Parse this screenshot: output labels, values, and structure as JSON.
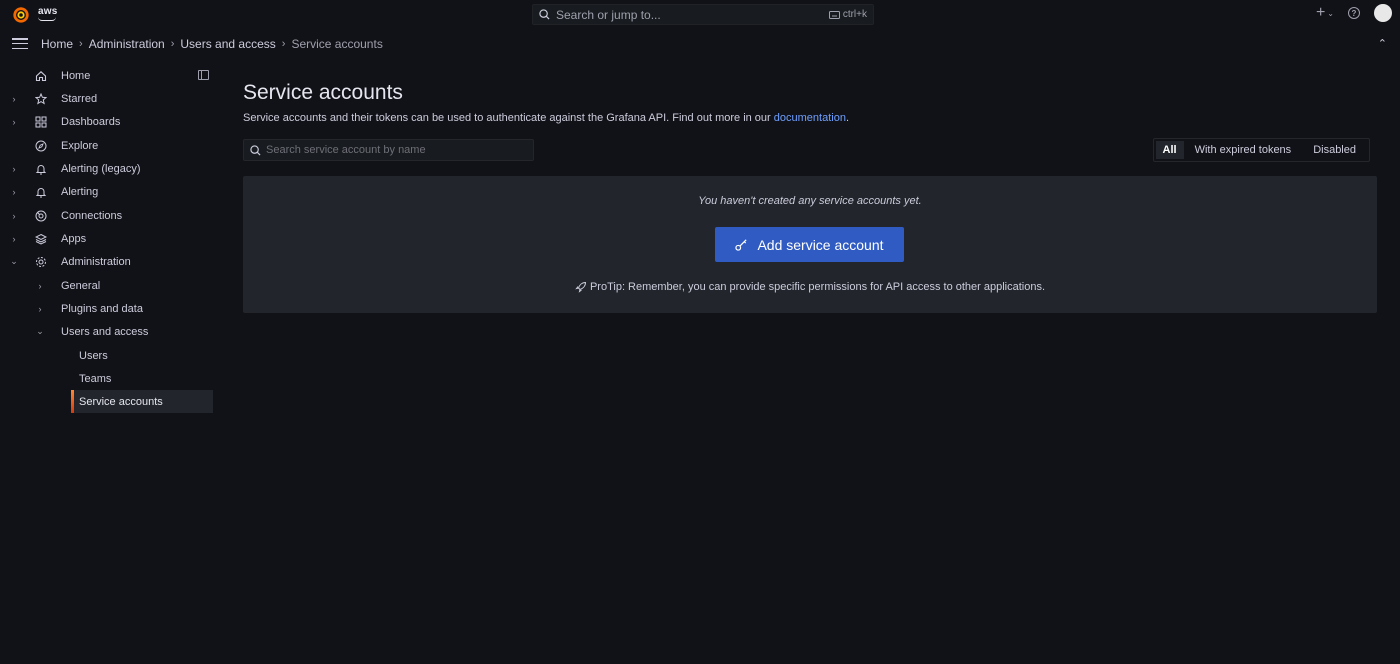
{
  "topbar": {
    "brand": "aws",
    "search_placeholder": "Search or jump to...",
    "search_shortcut": "ctrl+k",
    "plus_label": "+"
  },
  "breadcrumb": {
    "items": [
      "Home",
      "Administration",
      "Users and access",
      "Service accounts"
    ]
  },
  "sidebar": {
    "items": [
      {
        "label": "Home",
        "icon": "home-icon"
      },
      {
        "label": "Starred",
        "icon": "star-icon"
      },
      {
        "label": "Dashboards",
        "icon": "apps-grid-icon"
      },
      {
        "label": "Explore",
        "icon": "compass-icon"
      },
      {
        "label": "Alerting (legacy)",
        "icon": "bell-icon"
      },
      {
        "label": "Alerting",
        "icon": "bell-icon"
      },
      {
        "label": "Connections",
        "icon": "connections-icon"
      },
      {
        "label": "Apps",
        "icon": "layers-icon"
      },
      {
        "label": "Administration",
        "icon": "cog-icon"
      }
    ],
    "admin_children": [
      {
        "label": "General"
      },
      {
        "label": "Plugins and data"
      },
      {
        "label": "Users and access"
      }
    ],
    "users_access_children": [
      {
        "label": "Users"
      },
      {
        "label": "Teams"
      },
      {
        "label": "Service accounts"
      }
    ]
  },
  "main": {
    "title": "Service accounts",
    "description_prefix": "Service accounts and their tokens can be used to authenticate against the Grafana API. Find out more in our ",
    "description_link": "documentation",
    "description_suffix": ".",
    "search_placeholder": "Search service account by name",
    "filters": [
      "All",
      "With expired tokens",
      "Disabled"
    ],
    "selected_filter": "All",
    "empty_message": "You haven't created any service accounts yet.",
    "add_button": "Add service account",
    "protip": "ProTip: Remember, you can provide specific permissions for API access to other applications."
  },
  "colors": {
    "background": "#111217",
    "panel": "#22252b",
    "primary_button": "#2f5bc2",
    "link": "#6e9fff",
    "active_accent": "#f55f3e"
  }
}
